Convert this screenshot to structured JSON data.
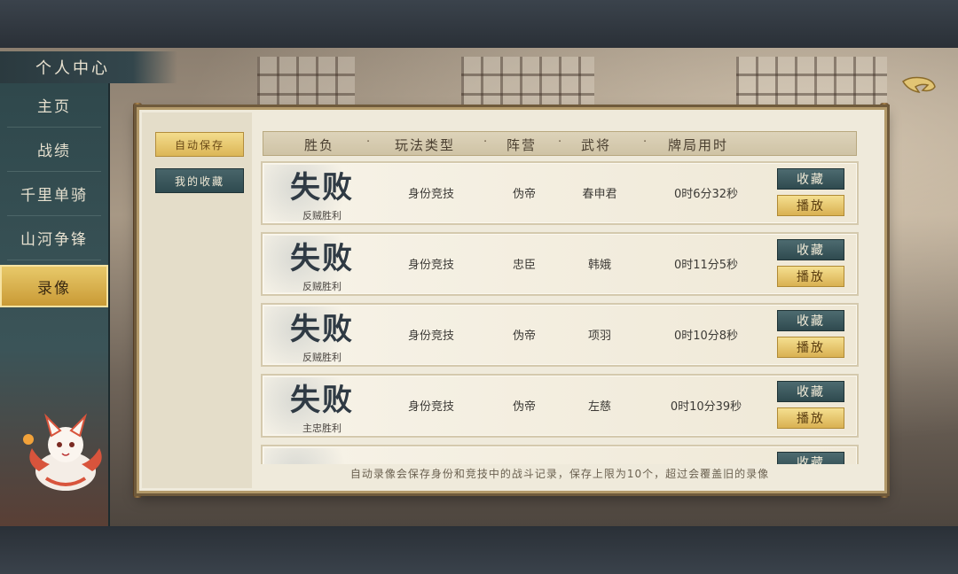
{
  "sidebar": {
    "title": "个人中心",
    "items": [
      {
        "label": "主页",
        "active": false
      },
      {
        "label": "战绩",
        "active": false
      },
      {
        "label": "千里单骑",
        "active": false
      },
      {
        "label": "山河争锋",
        "active": false
      },
      {
        "label": "录像",
        "active": true
      }
    ]
  },
  "tabs": {
    "auto_save": "自动保存",
    "favorites": "我的收藏"
  },
  "table": {
    "headers": [
      "胜负",
      "玩法类型",
      "阵营",
      "武将",
      "牌局用时"
    ],
    "separator": "·",
    "rows": [
      {
        "result": "失败",
        "result_detail": "反贼胜利",
        "mode": "身份竞技",
        "faction": "伪帝",
        "hero": "春申君",
        "duration": "0时6分32秒",
        "fav_label": "收藏",
        "play_label": "播放"
      },
      {
        "result": "失败",
        "result_detail": "反贼胜利",
        "mode": "身份竞技",
        "faction": "忠臣",
        "hero": "韩娥",
        "duration": "0时11分5秒",
        "fav_label": "收藏",
        "play_label": "播放"
      },
      {
        "result": "失败",
        "result_detail": "反贼胜利",
        "mode": "身份竞技",
        "faction": "伪帝",
        "hero": "项羽",
        "duration": "0时10分8秒",
        "fav_label": "收藏",
        "play_label": "播放"
      },
      {
        "result": "失败",
        "result_detail": "主忠胜利",
        "mode": "身份竞技",
        "faction": "伪帝",
        "hero": "左慈",
        "duration": "0时10分39秒",
        "fav_label": "收藏",
        "play_label": "播放"
      }
    ],
    "partial_row": {
      "fav_label": "收藏"
    }
  },
  "footer_note": "自动录像会保存身份和竞技中的战斗记录，保存上限为10个，超过会覆盖旧的录像",
  "colors": {
    "accent_gold": "#dcb657",
    "teal_button": "#2f4b50",
    "panel_bg": "#efeadb"
  }
}
